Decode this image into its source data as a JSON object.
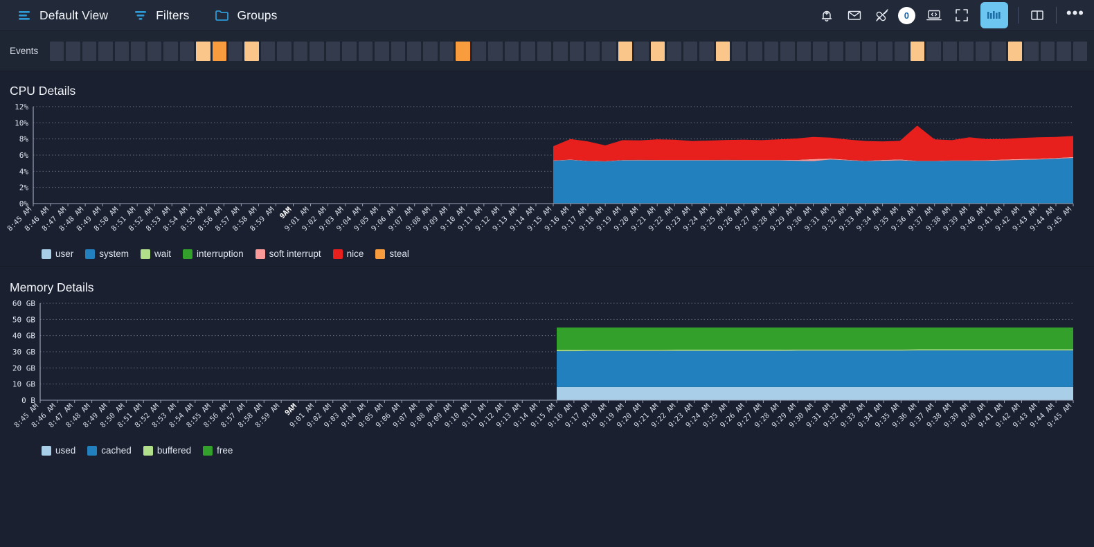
{
  "toolbar": {
    "left_items": [
      {
        "label": "Default View",
        "icon": "view-list-icon"
      },
      {
        "label": "Filters",
        "icon": "filter-icon"
      },
      {
        "label": "Groups",
        "icon": "folder-icon"
      }
    ],
    "right_icons": [
      {
        "name": "alert-bell-add-icon"
      },
      {
        "name": "mail-icon"
      },
      {
        "name": "plug-disconnect-icon"
      },
      {
        "name": "notification-count-badge",
        "value": "0"
      },
      {
        "name": "laptop-code-icon"
      },
      {
        "name": "fullscreen-icon"
      },
      {
        "name": "chart-bars-icon",
        "active": true
      },
      {
        "name": "split-panel-icon"
      },
      {
        "name": "overflow-menu-icon",
        "value": "•••"
      }
    ]
  },
  "events": {
    "label": "Events",
    "cell_count": 64,
    "lit_indices": [
      9,
      10,
      12,
      25,
      35,
      37,
      41,
      53,
      59
    ],
    "hot_indices": [
      10,
      25
    ],
    "colors": {
      "cell": "#333b4c",
      "lit": "#fbc68a",
      "hot": "#f89c3e"
    }
  },
  "cpu": {
    "title": "CPU Details",
    "legend": [
      {
        "label": "user",
        "color": "#a9cfe8"
      },
      {
        "label": "system",
        "color": "#2180bd"
      },
      {
        "label": "wait",
        "color": "#b2df8a"
      },
      {
        "label": "interruption",
        "color": "#33a02c"
      },
      {
        "label": "soft interrupt",
        "color": "#fb9a99"
      },
      {
        "label": "nice",
        "color": "#e8201d"
      },
      {
        "label": "steal",
        "color": "#f89c3e"
      }
    ]
  },
  "memory": {
    "title": "Memory Details",
    "legend": [
      {
        "label": "used",
        "color": "#a9cfe8"
      },
      {
        "label": "cached",
        "color": "#2180bd"
      },
      {
        "label": "buffered",
        "color": "#b2df8a"
      },
      {
        "label": "free",
        "color": "#33a02c"
      }
    ]
  },
  "chart_data": [
    {
      "type": "area",
      "id": "cpu",
      "title": "CPU Details",
      "xlabel": "",
      "ylabel": "",
      "ylim": [
        0,
        12
      ],
      "yticks": [
        "0%",
        "2%",
        "4%",
        "6%",
        "8%",
        "10%",
        "12%"
      ],
      "ytick_values": [
        0,
        2,
        4,
        6,
        8,
        10,
        12
      ],
      "grid": true,
      "legend_position": "bottom-left",
      "stacked": true,
      "data_start_x": "9:15 AM",
      "x": [
        "8:45 AM",
        "8:46 AM",
        "8:47 AM",
        "8:48 AM",
        "8:49 AM",
        "8:50 AM",
        "8:51 AM",
        "8:52 AM",
        "8:53 AM",
        "8:54 AM",
        "8:55 AM",
        "8:56 AM",
        "8:57 AM",
        "8:58 AM",
        "8:59 AM",
        "9AM",
        "9:01 AM",
        "9:02 AM",
        "9:03 AM",
        "9:04 AM",
        "9:05 AM",
        "9:06 AM",
        "9:07 AM",
        "9:08 AM",
        "9:09 AM",
        "9:10 AM",
        "9:11 AM",
        "9:12 AM",
        "9:13 AM",
        "9:14 AM",
        "9:15 AM",
        "9:16 AM",
        "9:17 AM",
        "9:18 AM",
        "9:19 AM",
        "9:20 AM",
        "9:21 AM",
        "9:22 AM",
        "9:23 AM",
        "9:24 AM",
        "9:25 AM",
        "9:26 AM",
        "9:27 AM",
        "9:28 AM",
        "9:29 AM",
        "9:30 AM",
        "9:31 AM",
        "9:32 AM",
        "9:33 AM",
        "9:34 AM",
        "9:35 AM",
        "9:36 AM",
        "9:37 AM",
        "9:38 AM",
        "9:39 AM",
        "9:40 AM",
        "9:41 AM",
        "9:42 AM",
        "9:43 AM",
        "9:44 AM",
        "9:45 AM"
      ],
      "bold_xticks": [
        "9AM"
      ],
      "series": [
        {
          "name": "user",
          "color": "#a9cfe8",
          "values": [
            null,
            null,
            null,
            null,
            null,
            null,
            null,
            null,
            null,
            null,
            null,
            null,
            null,
            null,
            null,
            null,
            null,
            null,
            null,
            null,
            null,
            null,
            null,
            null,
            null,
            null,
            null,
            null,
            null,
            null,
            0.05,
            0.05,
            0.05,
            0.05,
            0.05,
            0.05,
            0.05,
            0.05,
            0.05,
            0.05,
            0.05,
            0.05,
            0.05,
            0.05,
            0.05,
            0.05,
            0.05,
            0.05,
            0.05,
            0.05,
            0.05,
            0.05,
            0.05,
            0.05,
            0.05,
            0.05,
            0.05,
            0.05,
            0.05,
            0.05,
            0.05
          ]
        },
        {
          "name": "system",
          "color": "#2180bd",
          "values": [
            null,
            null,
            null,
            null,
            null,
            null,
            null,
            null,
            null,
            null,
            null,
            null,
            null,
            null,
            null,
            null,
            null,
            null,
            null,
            null,
            null,
            null,
            null,
            null,
            null,
            null,
            null,
            null,
            null,
            null,
            5.25,
            5.35,
            5.2,
            5.15,
            5.3,
            5.3,
            5.3,
            5.3,
            5.3,
            5.3,
            5.3,
            5.3,
            5.3,
            5.3,
            5.25,
            5.2,
            5.4,
            5.3,
            5.2,
            5.25,
            5.3,
            5.2,
            5.2,
            5.25,
            5.25,
            5.25,
            5.3,
            5.35,
            5.4,
            5.5,
            5.6
          ]
        },
        {
          "name": "wait",
          "color": "#b2df8a",
          "values": [
            null,
            null,
            null,
            null,
            null,
            null,
            null,
            null,
            null,
            null,
            null,
            null,
            null,
            null,
            null,
            null,
            null,
            null,
            null,
            null,
            null,
            null,
            null,
            null,
            null,
            null,
            null,
            null,
            null,
            null,
            0,
            0,
            0,
            0,
            0,
            0,
            0,
            0,
            0,
            0,
            0,
            0,
            0,
            0,
            0,
            0,
            0,
            0,
            0,
            0,
            0,
            0,
            0,
            0,
            0,
            0,
            0,
            0,
            0,
            0,
            0
          ]
        },
        {
          "name": "interruption",
          "color": "#33a02c",
          "values": [
            null,
            null,
            null,
            null,
            null,
            null,
            null,
            null,
            null,
            null,
            null,
            null,
            null,
            null,
            null,
            null,
            null,
            null,
            null,
            null,
            null,
            null,
            null,
            null,
            null,
            null,
            null,
            null,
            null,
            null,
            0,
            0,
            0,
            0,
            0,
            0,
            0,
            0,
            0,
            0,
            0,
            0,
            0,
            0,
            0,
            0,
            0,
            0,
            0,
            0,
            0,
            0,
            0,
            0,
            0,
            0,
            0,
            0,
            0,
            0,
            0
          ]
        },
        {
          "name": "soft interrupt",
          "color": "#fb9a99",
          "values": [
            null,
            null,
            null,
            null,
            null,
            null,
            null,
            null,
            null,
            null,
            null,
            null,
            null,
            null,
            null,
            null,
            null,
            null,
            null,
            null,
            null,
            null,
            null,
            null,
            null,
            null,
            null,
            null,
            null,
            null,
            0.05,
            0.05,
            0.05,
            0.05,
            0.05,
            0.08,
            0.05,
            0.05,
            0.05,
            0.05,
            0.08,
            0.05,
            0.05,
            0.05,
            0.1,
            0.25,
            0.12,
            0.08,
            0.05,
            0.1,
            0.12,
            0.05,
            0.05,
            0.05,
            0.05,
            0.08,
            0.1,
            0.12,
            0.1,
            0.1,
            0.12
          ]
        },
        {
          "name": "nice",
          "color": "#e8201d",
          "values": [
            null,
            null,
            null,
            null,
            null,
            null,
            null,
            null,
            null,
            null,
            null,
            null,
            null,
            null,
            null,
            null,
            null,
            null,
            null,
            null,
            null,
            null,
            null,
            null,
            null,
            null,
            null,
            null,
            null,
            null,
            1.75,
            2.55,
            2.4,
            1.95,
            2.45,
            2.4,
            2.55,
            2.5,
            2.35,
            2.4,
            2.45,
            2.5,
            2.45,
            2.55,
            2.65,
            2.75,
            2.6,
            2.5,
            2.45,
            2.3,
            2.3,
            4.35,
            2.65,
            2.5,
            2.85,
            2.6,
            2.55,
            2.6,
            2.65,
            2.6,
            2.6
          ]
        }
      ],
      "annotations": []
    },
    {
      "type": "area",
      "id": "memory",
      "title": "Memory Details",
      "xlabel": "",
      "ylabel": "",
      "ylim": [
        0,
        60
      ],
      "yticks": [
        "0 B",
        "10 GB",
        "20 GB",
        "30 GB",
        "40 GB",
        "50 GB",
        "60 GB"
      ],
      "ytick_values": [
        0,
        10,
        20,
        30,
        40,
        50,
        60
      ],
      "grid": true,
      "legend_position": "bottom-left",
      "stacked": true,
      "data_start_x": "9:15 AM",
      "x": [
        "8:45 AM",
        "8:46 AM",
        "8:47 AM",
        "8:48 AM",
        "8:49 AM",
        "8:50 AM",
        "8:51 AM",
        "8:52 AM",
        "8:53 AM",
        "8:54 AM",
        "8:55 AM",
        "8:56 AM",
        "8:57 AM",
        "8:58 AM",
        "8:59 AM",
        "9AM",
        "9:01 AM",
        "9:02 AM",
        "9:03 AM",
        "9:04 AM",
        "9:05 AM",
        "9:06 AM",
        "9:07 AM",
        "9:08 AM",
        "9:09 AM",
        "9:10 AM",
        "9:11 AM",
        "9:12 AM",
        "9:13 AM",
        "9:14 AM",
        "9:15 AM",
        "9:16 AM",
        "9:17 AM",
        "9:18 AM",
        "9:19 AM",
        "9:20 AM",
        "9:21 AM",
        "9:22 AM",
        "9:23 AM",
        "9:24 AM",
        "9:25 AM",
        "9:26 AM",
        "9:27 AM",
        "9:28 AM",
        "9:29 AM",
        "9:30 AM",
        "9:31 AM",
        "9:32 AM",
        "9:33 AM",
        "9:34 AM",
        "9:35 AM",
        "9:36 AM",
        "9:37 AM",
        "9:38 AM",
        "9:39 AM",
        "9:40 AM",
        "9:41 AM",
        "9:42 AM",
        "9:43 AM",
        "9:44 AM",
        "9:45 AM"
      ],
      "bold_xticks": [
        "9AM"
      ],
      "series": [
        {
          "name": "used",
          "color": "#a9cfe8",
          "values": [
            null,
            null,
            null,
            null,
            null,
            null,
            null,
            null,
            null,
            null,
            null,
            null,
            null,
            null,
            null,
            null,
            null,
            null,
            null,
            null,
            null,
            null,
            null,
            null,
            null,
            null,
            null,
            null,
            null,
            null,
            8.2,
            8.2,
            8.2,
            8.2,
            8.2,
            8.2,
            8.2,
            8.2,
            8.2,
            8.2,
            8.2,
            8.2,
            8.2,
            8.2,
            8.2,
            8.2,
            8.2,
            8.2,
            8.2,
            8.2,
            8.2,
            8.2,
            8.2,
            8.2,
            8.2,
            8.2,
            8.2,
            8.2,
            8.2,
            8.2,
            8.2
          ]
        },
        {
          "name": "cached",
          "color": "#2180bd",
          "values": [
            null,
            null,
            null,
            null,
            null,
            null,
            null,
            null,
            null,
            null,
            null,
            null,
            null,
            null,
            null,
            null,
            null,
            null,
            null,
            null,
            null,
            null,
            null,
            null,
            null,
            null,
            null,
            null,
            null,
            null,
            22.2,
            22.2,
            22.3,
            22.3,
            22.3,
            22.3,
            22.3,
            22.4,
            22.4,
            22.4,
            22.4,
            22.4,
            22.4,
            22.4,
            22.5,
            22.5,
            22.5,
            22.5,
            22.5,
            22.5,
            22.5,
            22.6,
            22.6,
            22.6,
            22.6,
            22.6,
            22.6,
            22.6,
            22.6,
            22.6,
            22.6
          ]
        },
        {
          "name": "buffered",
          "color": "#b2df8a",
          "values": [
            null,
            null,
            null,
            null,
            null,
            null,
            null,
            null,
            null,
            null,
            null,
            null,
            null,
            null,
            null,
            null,
            null,
            null,
            null,
            null,
            null,
            null,
            null,
            null,
            null,
            null,
            null,
            null,
            null,
            null,
            0.7,
            0.7,
            0.7,
            0.7,
            0.7,
            0.7,
            0.7,
            0.7,
            0.7,
            0.7,
            0.7,
            0.7,
            0.7,
            0.7,
            0.7,
            0.7,
            0.7,
            0.7,
            0.7,
            0.7,
            0.7,
            0.7,
            0.7,
            0.7,
            0.7,
            0.7,
            0.7,
            0.7,
            0.7,
            0.7,
            0.7
          ]
        },
        {
          "name": "free",
          "color": "#33a02c",
          "values": [
            null,
            null,
            null,
            null,
            null,
            null,
            null,
            null,
            null,
            null,
            null,
            null,
            null,
            null,
            null,
            null,
            null,
            null,
            null,
            null,
            null,
            null,
            null,
            null,
            null,
            null,
            null,
            null,
            null,
            null,
            13.9,
            13.9,
            13.8,
            13.8,
            13.8,
            13.8,
            13.8,
            13.7,
            13.7,
            13.7,
            13.7,
            13.7,
            13.7,
            13.7,
            13.6,
            13.6,
            13.6,
            13.6,
            13.6,
            13.6,
            13.6,
            13.5,
            13.5,
            13.5,
            13.5,
            13.5,
            13.5,
            13.5,
            13.5,
            13.5,
            13.5
          ]
        }
      ],
      "annotations": []
    }
  ]
}
